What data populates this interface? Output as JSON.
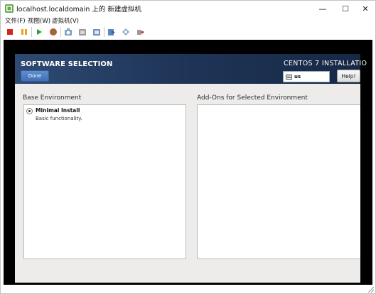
{
  "window": {
    "title": "localhost.localdomain 上的 新建虚拟机",
    "minimize": "—",
    "maximize": "☐",
    "close": "✕"
  },
  "menu": [
    {
      "label": "文件(F)"
    },
    {
      "label": "视图(W)"
    },
    {
      "label": "虚拟机(V)"
    }
  ],
  "toolbar": {
    "icons": [
      "stop-icon",
      "pause-icon",
      "play-icon",
      "refresh-guest-icon",
      "snapshot-icon",
      "revert-snapshot-icon",
      "manage-snapshots-icon",
      "send-file-icon",
      "settings-icon",
      "usb-icon"
    ],
    "colors": {
      "stop": "#d9221c",
      "pause": "#e6a51b",
      "play": "#2aa52a"
    }
  },
  "anaconda": {
    "spoke_title": "SOFTWARE SELECTION",
    "done_label": "Done",
    "product_title": "CENTOS 7 INSTALLATIO",
    "keyboard_layout": "us",
    "help_label": "Help!",
    "header_color": "#1f3659",
    "done_color": "#4a7ac0"
  },
  "software": {
    "base_env_label": "Base Environment",
    "addons_label": "Add-Ons for Selected Environment",
    "environments": [
      {
        "name": "Minimal Install",
        "description": "Basic functionality.",
        "selected": true
      }
    ]
  }
}
